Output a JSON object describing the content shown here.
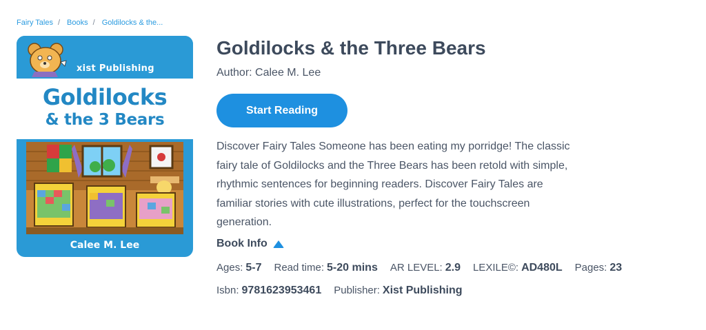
{
  "breadcrumb": {
    "items": [
      "Fairy Tales",
      "Books",
      "Goldilocks & the..."
    ],
    "separator": "/"
  },
  "cover": {
    "publisher": "xist Publishing",
    "title_line1": "Goldilocks",
    "title_line2": "& the 3 Bears",
    "author": "Calee M. Lee",
    "background_color": "#2a9ad6"
  },
  "book": {
    "title": "Goldilocks & the Three Bears",
    "author_label": "Author:",
    "author": "Calee M. Lee",
    "start_button": "Start Reading",
    "description": "Discover Fairy Tales Someone has been eating my porridge! The classic fairy tale of Goldilocks and the Three Bears has been retold with simple, rhythmic sentences for beginning readers. Discover Fairy Tales are familiar stories with cute illustrations, perfect for the touchscreen generation.",
    "book_info_label": "Book Info"
  },
  "meta": {
    "ages_label": "Ages:",
    "ages": "5-7",
    "readtime_label": "Read time:",
    "readtime": "5-20 mins",
    "ar_label": "AR LEVEL:",
    "ar": "2.9",
    "lexile_label": "LEXILE©:",
    "lexile": "AD480L",
    "pages_label": "Pages:",
    "pages": "23",
    "isbn_label": "Isbn:",
    "isbn": "9781623953461",
    "publisher_label": "Publisher:",
    "publisher": "Xist Publishing"
  },
  "colors": {
    "accent": "#1e90e0",
    "link": "#2b9be0",
    "text": "#3d4a5c"
  }
}
